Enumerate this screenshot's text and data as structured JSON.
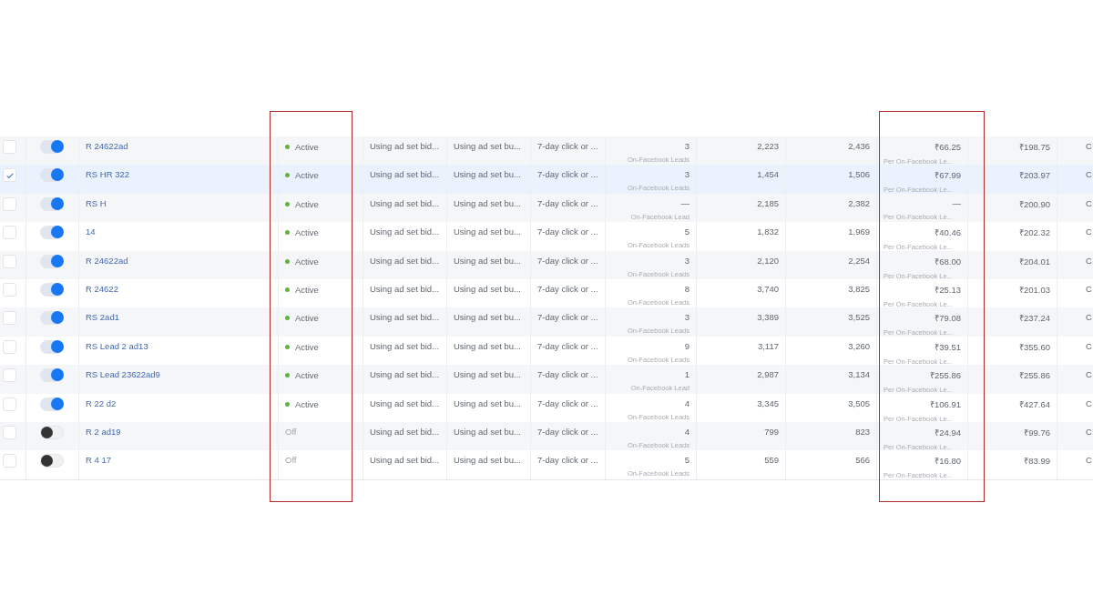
{
  "status_column_framed": true,
  "cost_column_framed": true,
  "rows": [
    {
      "selected": false,
      "on": true,
      "name": "R 24622ad",
      "status": {
        "text": "Active",
        "active": true
      },
      "bid": "Using ad set bid...",
      "budget": "Using ad set bu...",
      "attribution": "7-day click or ...",
      "results": "3",
      "results_label": "On-Facebook Leads",
      "reach": "2,223",
      "impressions": "2,436",
      "cost": "₹66.25",
      "cost_label": "Per On-Facebook Le...",
      "spent": "₹198.75",
      "column_13": "C"
    },
    {
      "selected": true,
      "on": true,
      "name": "RS HR 322",
      "status": {
        "text": "Active",
        "active": true
      },
      "bid": "Using ad set bid...",
      "budget": "Using ad set bu...",
      "attribution": "7-day click or ...",
      "results": "3",
      "results_label": "On-Facebook Leads",
      "reach": "1,454",
      "impressions": "1,506",
      "cost": "₹67.99",
      "cost_label": "Per On-Facebook Le...",
      "spent": "₹203.97",
      "column_13": "C"
    },
    {
      "selected": false,
      "on": true,
      "name": "RS H",
      "status": {
        "text": "Active",
        "active": true
      },
      "bid": "Using ad set bid...",
      "budget": "Using ad set bu...",
      "attribution": "7-day click or ...",
      "results": "—",
      "results_label": "On-Facebook Lead",
      "reach": "2,185",
      "impressions": "2,382",
      "cost": "—",
      "cost_label": "Per On-Facebook Le...",
      "spent": "₹200.90",
      "column_13": "C"
    },
    {
      "selected": false,
      "on": true,
      "name": "14",
      "status": {
        "text": "Active",
        "active": true
      },
      "bid": "Using ad set bid...",
      "budget": "Using ad set bu...",
      "attribution": "7-day click or ...",
      "results": "5",
      "results_label": "On-Facebook Leads",
      "reach": "1,832",
      "impressions": "1,969",
      "cost": "₹40.46",
      "cost_label": "Per On-Facebook Le...",
      "spent": "₹202.32",
      "column_13": "C"
    },
    {
      "selected": false,
      "on": true,
      "name": "R 24622ad",
      "status": {
        "text": "Active",
        "active": true
      },
      "bid": "Using ad set bid...",
      "budget": "Using ad set bu...",
      "attribution": "7-day click or ...",
      "results": "3",
      "results_label": "On-Facebook Leads",
      "reach": "2,120",
      "impressions": "2,254",
      "cost": "₹68.00",
      "cost_label": "Per On-Facebook Le...",
      "spent": "₹204.01",
      "column_13": "C"
    },
    {
      "selected": false,
      "on": true,
      "name": "R 24622",
      "status": {
        "text": "Active",
        "active": true
      },
      "bid": "Using ad set bid...",
      "budget": "Using ad set bu...",
      "attribution": "7-day click or ...",
      "results": "8",
      "results_label": "On-Facebook Leads",
      "reach": "3,740",
      "impressions": "3,825",
      "cost": "₹25.13",
      "cost_label": "Per On-Facebook Le...",
      "spent": "₹201.03",
      "column_13": "C"
    },
    {
      "selected": false,
      "on": true,
      "name": "RS 2ad1",
      "status": {
        "text": "Active",
        "active": true
      },
      "bid": "Using ad set bid...",
      "budget": "Using ad set bu...",
      "attribution": "7-day click or ...",
      "results": "3",
      "results_label": "On-Facebook Leads",
      "reach": "3,389",
      "impressions": "3,525",
      "cost": "₹79.08",
      "cost_label": "Per On-Facebook Le...",
      "spent": "₹237.24",
      "column_13": "C"
    },
    {
      "selected": false,
      "on": true,
      "name": "RS Lead 2 ad13",
      "status": {
        "text": "Active",
        "active": true
      },
      "bid": "Using ad set bid...",
      "budget": "Using ad set bu...",
      "attribution": "7-day click or ...",
      "results": "9",
      "results_label": "On-Facebook Leads",
      "reach": "3,117",
      "impressions": "3,260",
      "cost": "₹39.51",
      "cost_label": "Per On-Facebook Le...",
      "spent": "₹355.60",
      "column_13": "C"
    },
    {
      "selected": false,
      "on": true,
      "name": "RS Lead 23622ad9",
      "status": {
        "text": "Active",
        "active": true
      },
      "bid": "Using ad set bid...",
      "budget": "Using ad set bu...",
      "attribution": "7-day click or ...",
      "results": "1",
      "results_label": "On-Facebook Lead",
      "reach": "2,987",
      "impressions": "3,134",
      "cost": "₹255.86",
      "cost_label": "Per On-Facebook Le...",
      "spent": "₹255.86",
      "column_13": "C"
    },
    {
      "selected": false,
      "on": true,
      "name": "R 22 d2",
      "status": {
        "text": "Active",
        "active": true
      },
      "bid": "Using ad set bid...",
      "budget": "Using ad set bu...",
      "attribution": "7-day click or ...",
      "results": "4",
      "results_label": "On-Facebook Leads",
      "reach": "3,345",
      "impressions": "3,505",
      "cost": "₹106.91",
      "cost_label": "Per On-Facebook Le...",
      "spent": "₹427.64",
      "column_13": "C"
    },
    {
      "selected": false,
      "on": false,
      "name": "R 2 ad19",
      "status": {
        "text": "Off",
        "active": false
      },
      "bid": "Using ad set bid...",
      "budget": "Using ad set bu...",
      "attribution": "7-day click or ...",
      "results": "4",
      "results_label": "On-Facebook Leads",
      "reach": "799",
      "impressions": "823",
      "cost": "₹24.94",
      "cost_label": "Per On-Facebook Le...",
      "spent": "₹99.76",
      "column_13": "C"
    },
    {
      "selected": false,
      "on": false,
      "name": "R 4 17",
      "status": {
        "text": "Off",
        "active": false
      },
      "bid": "Using ad set bid...",
      "budget": "Using ad set bu...",
      "attribution": "7-day click or ...",
      "results": "5",
      "results_label": "On-Facebook Leads",
      "reach": "559",
      "impressions": "566",
      "cost": "₹16.80",
      "cost_label": "Per On-Facebook Le...",
      "spent": "₹83.99",
      "column_13": "C"
    }
  ]
}
